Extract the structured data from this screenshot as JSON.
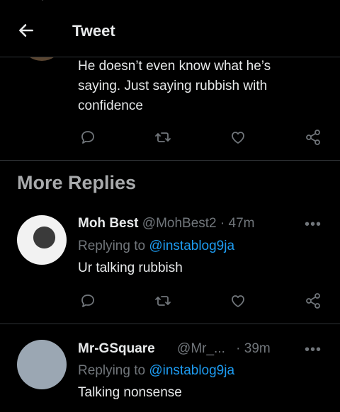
{
  "header": {
    "title": "Tweet",
    "back_icon": "arrow-left-icon"
  },
  "previous_reply": {
    "text": "He doesn’t even know what he’s saying.  Just saying rubbish with confidence"
  },
  "section": {
    "title": "More Replies"
  },
  "replies": [
    {
      "name": "Moh Best",
      "handle": "@MohBest2",
      "time": "· 47m",
      "replying_prefix": "Replying to ",
      "replying_to": "@instablog9ja",
      "text": "Ur talking rubbish"
    },
    {
      "name": "Mr-GSquare",
      "handle": "@Mr_...",
      "time": "· 39m",
      "replying_prefix": "Replying to ",
      "replying_to": "@instablog9ja",
      "text": "Talking nonsense"
    }
  ],
  "colors": {
    "background": "#000000",
    "text": "#e7e9ea",
    "muted": "#71767b",
    "accent": "#1d9bf0",
    "divider": "#2f3336"
  }
}
